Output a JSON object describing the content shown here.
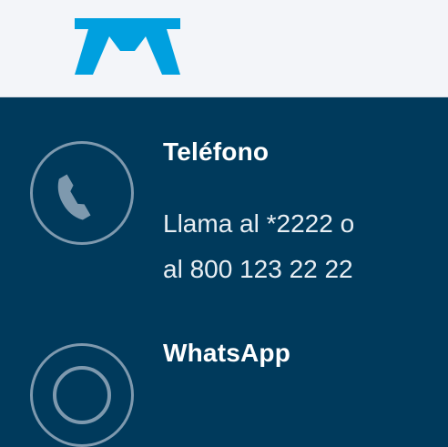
{
  "header": {
    "logo_icon": "telmex-logo-icon",
    "logo_color": "#00a0df"
  },
  "contacts": [
    {
      "icon": "phone-icon",
      "title": "Teléfono",
      "line1": "Llama al *2222 o",
      "line2": "al 800 123 22 22"
    },
    {
      "icon": "whatsapp-icon",
      "title": "WhatsApp"
    }
  ],
  "colors": {
    "header_bg": "#f3f5f9",
    "panel_bg": "#003a5c",
    "icon_stroke": "#7e99ae",
    "text": "#ffffff"
  }
}
